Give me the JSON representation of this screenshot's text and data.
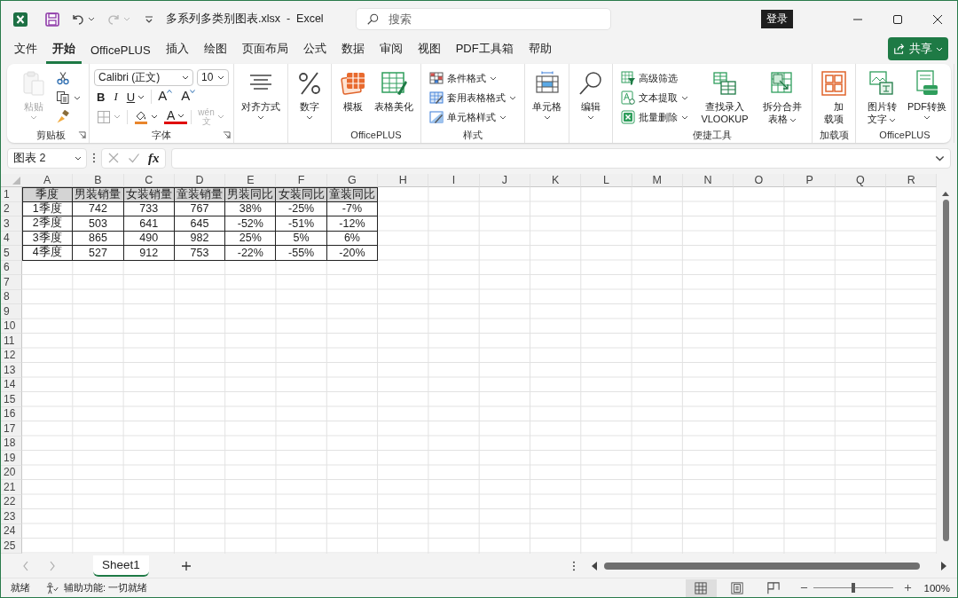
{
  "title_bar": {
    "file_title": "多系列多类别图表.xlsx  -  Excel",
    "search_placeholder": "搜索",
    "login_button": "登录",
    "redo_disabled": true
  },
  "menu_tabs": [
    {
      "label": "文件",
      "selected": false
    },
    {
      "label": "开始",
      "selected": true
    },
    {
      "label": "OfficePLUS",
      "selected": false
    },
    {
      "label": "插入",
      "selected": false
    },
    {
      "label": "绘图",
      "selected": false
    },
    {
      "label": "页面布局",
      "selected": false
    },
    {
      "label": "公式",
      "selected": false
    },
    {
      "label": "数据",
      "selected": false
    },
    {
      "label": "审阅",
      "selected": false
    },
    {
      "label": "视图",
      "selected": false
    },
    {
      "label": "PDF工具箱",
      "selected": false
    },
    {
      "label": "帮助",
      "selected": false
    }
  ],
  "share_button": "共享",
  "ribbon_groups": [
    {
      "label": "剪贴板",
      "launcher": true,
      "items": [
        {
          "kind": "large",
          "label": "粘贴",
          "dropdown": true,
          "disabled": true
        },
        {
          "kind": "icon",
          "dropdown": false,
          "disabled": false
        },
        {
          "kind": "icon",
          "dropdown": true,
          "disabled": false
        },
        {
          "kind": "icon",
          "dropdown": false,
          "disabled": false
        }
      ]
    },
    {
      "kind": "font",
      "label": "字体",
      "launcher": true,
      "font_name": "Calibri (正文)",
      "font_size": "10",
      "style_buttons": [
        {
          "label": "B",
          "dropdown": false
        },
        {
          "label": "I",
          "dropdown": false
        },
        {
          "label": "U",
          "dropdown": true
        }
      ],
      "grow": "A",
      "shrink": "A",
      "font_color": "A",
      "phonetic": {
        "label": "wén\n文",
        "disabled": true
      }
    },
    {
      "items": [
        {
          "kind": "large",
          "label": "对齐方式",
          "dropdown": true,
          "disabled": false
        }
      ]
    },
    {
      "items": [
        {
          "kind": "large",
          "label": "数字",
          "dropdown": true,
          "disabled": false
        }
      ]
    },
    {
      "label": "OfficePLUS",
      "items": [
        {
          "kind": "large",
          "label": "模板",
          "dropdown": false,
          "disabled": false
        },
        {
          "kind": "large",
          "label": "表格美化",
          "dropdown": false,
          "disabled": false
        }
      ]
    },
    {
      "label": "样式",
      "items": [
        {
          "kind": "small",
          "label": "条件格式",
          "dropdown": true,
          "disabled": false
        },
        {
          "kind": "small",
          "label": "套用表格格式",
          "dropdown": true,
          "disabled": false
        },
        {
          "kind": "small",
          "label": "单元格样式",
          "dropdown": true,
          "disabled": false
        }
      ]
    },
    {
      "items": [
        {
          "kind": "large",
          "label": "单元格",
          "dropdown": true,
          "disabled": false
        }
      ]
    },
    {
      "items": [
        {
          "kind": "large",
          "label": "编辑",
          "dropdown": true,
          "disabled": false
        }
      ]
    },
    {
      "label": "便捷工具",
      "items": [
        {
          "kind": "small",
          "label": "高级筛选",
          "dropdown": false,
          "disabled": false
        },
        {
          "kind": "small",
          "label": "文本提取",
          "dropdown": true,
          "disabled": false
        },
        {
          "kind": "small",
          "label": "批量删除",
          "dropdown": true,
          "disabled": false
        },
        {
          "kind": "large",
          "label": "查找录入 VLOOKUP",
          "dropdown": false,
          "disabled": false
        },
        {
          "kind": "large",
          "label": "拆分合并表格",
          "dropdown": true,
          "disabled": false
        }
      ]
    },
    {
      "label": "加载项",
      "items": [
        {
          "kind": "large",
          "label": "加载项",
          "dropdown": false,
          "disabled": false
        }
      ]
    },
    {
      "label": "OfficePLUS",
      "items": [
        {
          "kind": "large",
          "label": "图片转文字",
          "dropdown": true,
          "disabled": false
        },
        {
          "kind": "large",
          "label": "PDF转换",
          "dropdown": true,
          "disabled": false
        }
      ]
    }
  ],
  "formula_bar": {
    "name_box": "图表 2",
    "fx": "fx"
  },
  "sheet": {
    "columns": [
      "A",
      "B",
      "C",
      "D",
      "E",
      "F",
      "G",
      "H",
      "I",
      "J",
      "K",
      "L",
      "M",
      "N",
      "O",
      "P",
      "Q",
      "R"
    ],
    "row_numbers": [
      "1",
      "2",
      "3",
      "4",
      "5",
      "6",
      "7",
      "8",
      "9",
      "10",
      "11",
      "12",
      "13",
      "14",
      "15",
      "16",
      "17",
      "18",
      "19",
      "20",
      "21",
      "22",
      "23",
      "24",
      "25"
    ],
    "rows": [
      {
        "shaded": true,
        "cells": [
          "季度",
          "男装销量",
          "女装销量",
          "童装销量",
          "男装同比",
          "女装同比",
          "童装同比"
        ]
      },
      {
        "shaded": false,
        "cells": [
          "1季度",
          "742",
          "733",
          "767",
          "38%",
          "-25%",
          "-7%"
        ]
      },
      {
        "shaded": false,
        "cells": [
          "2季度",
          "503",
          "641",
          "645",
          "-52%",
          "-51%",
          "-12%"
        ]
      },
      {
        "shaded": false,
        "cells": [
          "3季度",
          "865",
          "490",
          "982",
          "25%",
          "5%",
          "6%"
        ]
      },
      {
        "shaded": false,
        "cells": [
          "4季度",
          "527",
          "912",
          "753",
          "-22%",
          "-55%",
          "-20%"
        ]
      }
    ]
  },
  "sheet_tabs": [
    {
      "label": "Sheet1",
      "selected": true
    }
  ],
  "status_bar": {
    "ready": "就绪",
    "accessibility": "辅助功能: 一切就绪",
    "views": [
      {
        "selected": true
      },
      {
        "selected": false
      },
      {
        "selected": false
      }
    ],
    "zoom": {
      "level": 0.5,
      "reading": "100%"
    }
  }
}
